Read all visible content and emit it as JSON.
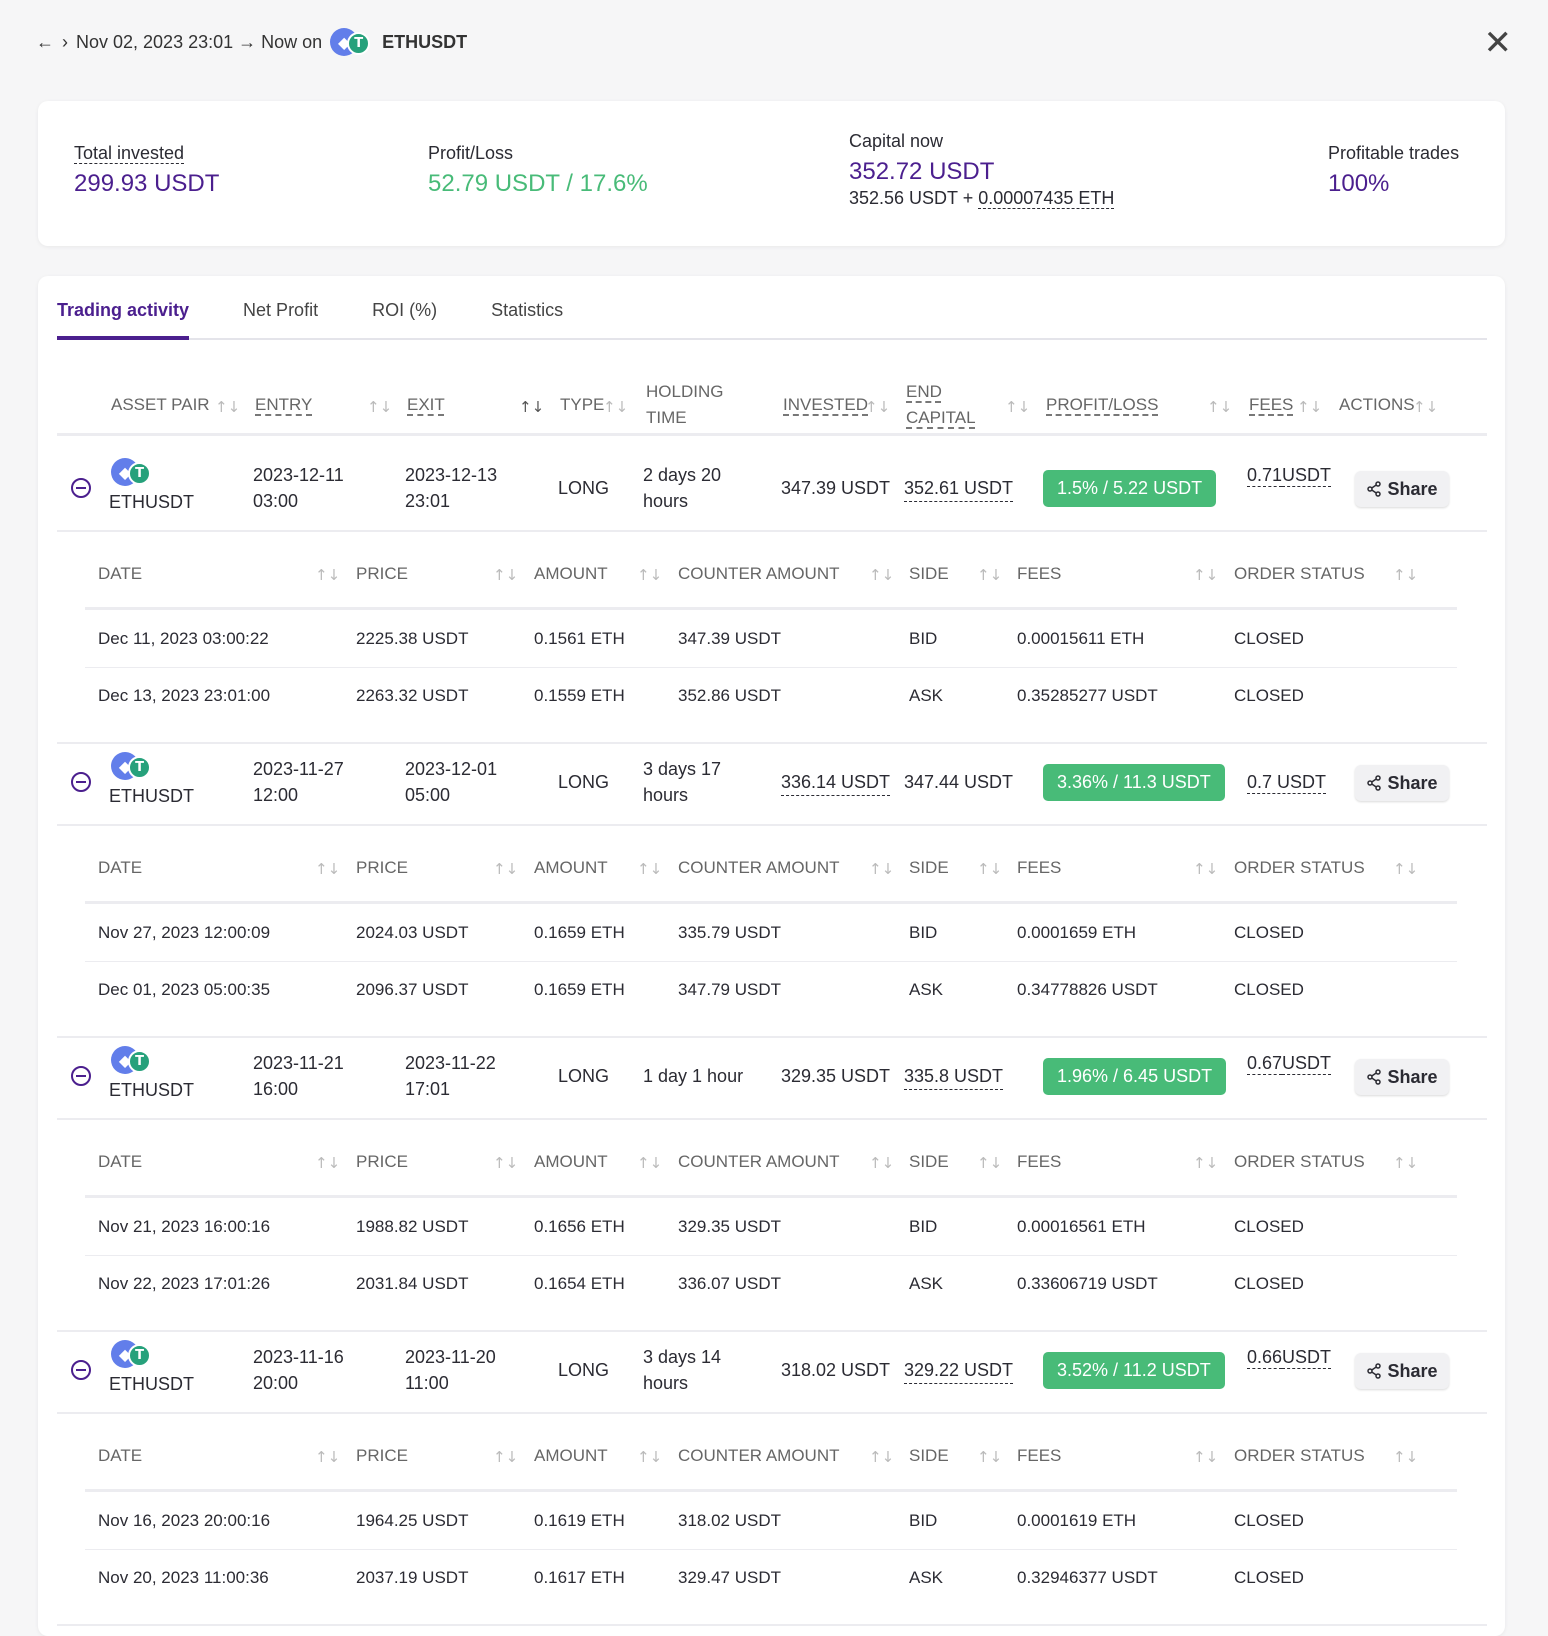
{
  "header": {
    "back_icon": "←",
    "forward_icon": "›",
    "range": "Nov 02, 2023 23:01 → Now on",
    "pair": "ETHUSDT",
    "close_icon": "✕"
  },
  "summary": {
    "total_invested_label": "Total invested",
    "total_invested": "299.93 USDT",
    "profit_loss_label": "Profit/Loss",
    "profit_loss": "52.79 USDT / 17.6%",
    "capital_now_label": "Capital now",
    "capital_now": "352.72 USDT",
    "capital_breakdown_usdt": "352.56 USDT + ",
    "capital_breakdown_eth": "0.00007435 ETH",
    "profitable_label": "Profitable trades",
    "profitable": "100%"
  },
  "tabs": [
    "Trading activity",
    "Net Profit",
    "ROI (%)",
    "Statistics"
  ],
  "columns": {
    "asset_pair": "ASSET PAIR",
    "entry": "ENTRY",
    "exit": "EXIT",
    "type": "TYPE",
    "holding_1": "HOLDING",
    "holding_2": "TIME",
    "invested": "INVESTED",
    "end_1": "END",
    "end_2": "CAPITAL",
    "profit_loss": "PROFIT/LOSS",
    "fees": "FEES",
    "actions": "ACTIONS"
  },
  "order_columns": {
    "date": "DATE",
    "price": "PRICE",
    "amount": "AMOUNT",
    "counter": "COUNTER AMOUNT",
    "side": "SIDE",
    "fees": "FEES",
    "status": "ORDER STATUS"
  },
  "share_label": "Share",
  "trades": [
    {
      "pair": "ETHUSDT",
      "entry_date": "2023-12-11",
      "entry_time": "03:00",
      "exit_date": "2023-12-13",
      "exit_time": "23:01",
      "type": "LONG",
      "holding_1": "2 days 20",
      "holding_2": "hours",
      "invested": "347.39 USDT",
      "end_capital": "352.61 USDT",
      "profit": "1.5% / 5.22 USDT",
      "fees_1": "0.71",
      "fees_2": "USDT",
      "orders": [
        {
          "date": "Dec 11, 2023 03:00:22",
          "price": "2225.38 USDT",
          "amount": "0.1561 ETH",
          "counter": "347.39 USDT",
          "side": "BID",
          "fees": "0.00015611 ETH",
          "status": "CLOSED"
        },
        {
          "date": "Dec 13, 2023 23:01:00",
          "price": "2263.32 USDT",
          "amount": "0.1559 ETH",
          "counter": "352.86 USDT",
          "side": "ASK",
          "fees": "0.35285277 USDT",
          "status": "CLOSED"
        }
      ]
    },
    {
      "pair": "ETHUSDT",
      "entry_date": "2023-11-27",
      "entry_time": "12:00",
      "exit_date": "2023-12-01",
      "exit_time": "05:00",
      "type": "LONG",
      "holding_1": "3 days 17",
      "holding_2": "hours",
      "invested": "336.14 USDT",
      "end_capital": "347.44 USDT",
      "profit": "3.36% / 11.3 USDT",
      "fees_1": "0.7 USDT",
      "fees_2": "",
      "orders": [
        {
          "date": "Nov 27, 2023 12:00:09",
          "price": "2024.03 USDT",
          "amount": "0.1659 ETH",
          "counter": "335.79 USDT",
          "side": "BID",
          "fees": "0.0001659 ETH",
          "status": "CLOSED"
        },
        {
          "date": "Dec 01, 2023 05:00:35",
          "price": "2096.37 USDT",
          "amount": "0.1659 ETH",
          "counter": "347.79 USDT",
          "side": "ASK",
          "fees": "0.34778826 USDT",
          "status": "CLOSED"
        }
      ]
    },
    {
      "pair": "ETHUSDT",
      "entry_date": "2023-11-21",
      "entry_time": "16:00",
      "exit_date": "2023-11-22",
      "exit_time": "17:01",
      "type": "LONG",
      "holding_1": "1 day 1 hour",
      "holding_2": "",
      "invested": "329.35 USDT",
      "end_capital": "335.8 USDT",
      "profit": "1.96% / 6.45 USDT",
      "fees_1": "0.67",
      "fees_2": "USDT",
      "orders": [
        {
          "date": "Nov 21, 2023 16:00:16",
          "price": "1988.82 USDT",
          "amount": "0.1656 ETH",
          "counter": "329.35 USDT",
          "side": "BID",
          "fees": "0.00016561 ETH",
          "status": "CLOSED"
        },
        {
          "date": "Nov 22, 2023 17:01:26",
          "price": "2031.84 USDT",
          "amount": "0.1654 ETH",
          "counter": "336.07 USDT",
          "side": "ASK",
          "fees": "0.33606719 USDT",
          "status": "CLOSED"
        }
      ]
    },
    {
      "pair": "ETHUSDT",
      "entry_date": "2023-11-16",
      "entry_time": "20:00",
      "exit_date": "2023-11-20",
      "exit_time": "11:00",
      "type": "LONG",
      "holding_1": "3 days 14",
      "holding_2": "hours",
      "invested": "318.02 USDT",
      "end_capital": "329.22 USDT",
      "profit": "3.52% / 11.2 USDT",
      "fees_1": "0.66",
      "fees_2": "USDT",
      "orders": [
        {
          "date": "Nov 16, 2023 20:00:16",
          "price": "1964.25 USDT",
          "amount": "0.1619 ETH",
          "counter": "318.02 USDT",
          "side": "BID",
          "fees": "0.0001619 ETH",
          "status": "CLOSED"
        },
        {
          "date": "Nov 20, 2023 11:00:36",
          "price": "2037.19 USDT",
          "amount": "0.1617 ETH",
          "counter": "329.47 USDT",
          "side": "ASK",
          "fees": "0.32946377 USDT",
          "status": "CLOSED"
        }
      ]
    }
  ]
}
